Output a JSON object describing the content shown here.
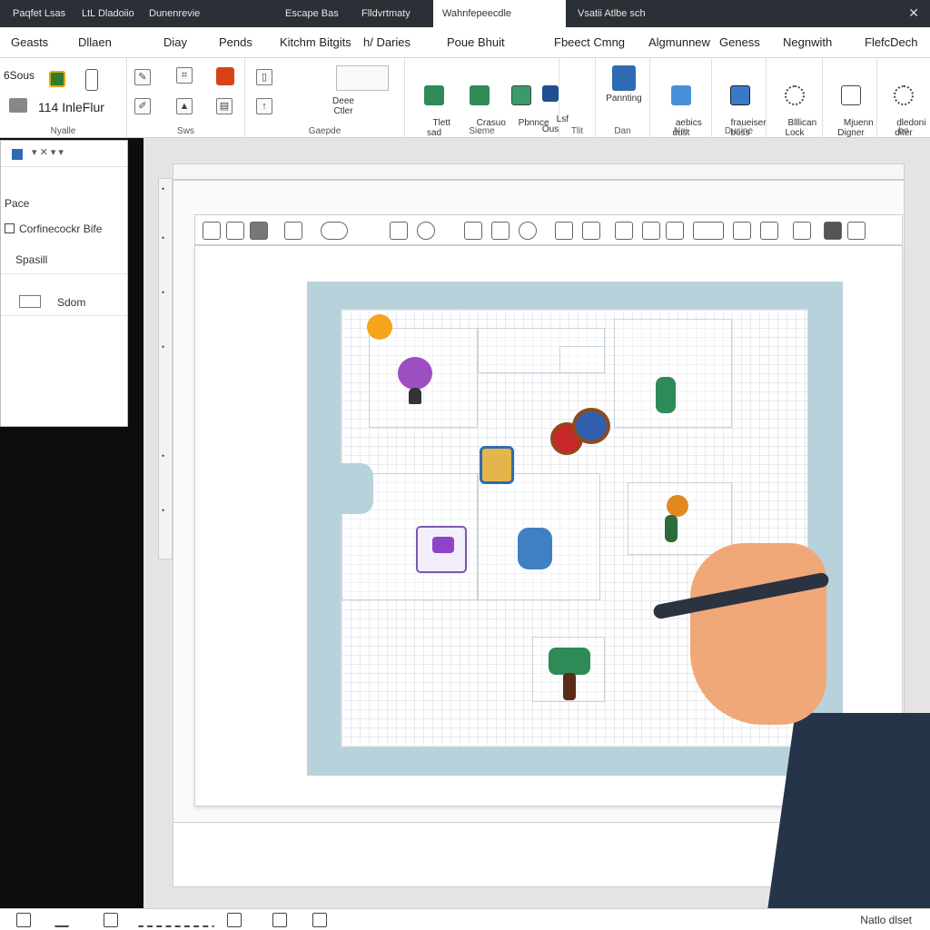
{
  "title_tabs": [
    "Paqfet Lsas",
    "LtL Dladoiio",
    "Dunenrevie",
    "Escape Bas",
    "Flldvrtmaty",
    "Wahnfepeecdle",
    "Vsatii Atlbe sch"
  ],
  "title_close": "✕",
  "menu": [
    "Geasts",
    "Dllaen",
    "Diay",
    "Pends",
    "Kitchm Bitgits",
    "h/ Daries",
    "Poue Bhuit",
    "Fbeect Cmng",
    "Algmunnew",
    "Geness",
    "Negnwith",
    "FlefcDech"
  ],
  "ribbon": {
    "left_label_top": "6Sous",
    "left_label_bottom": "114 InleFlur",
    "groups": [
      "Nyalle",
      "Sws",
      "Gaepde",
      "Sieme",
      "Tlit",
      "Dan",
      "Nei",
      "Dusine",
      "bo"
    ],
    "buttons": [
      {
        "label": "Deee\nCtler"
      },
      {
        "label": "Tlett\nsad"
      },
      {
        "label": "Crasuo\n-"
      },
      {
        "label": "Pbnnce"
      },
      {
        "label": "Lsf\nOus"
      },
      {
        "label": "Pannting"
      },
      {
        "label": "aebics\ndust"
      },
      {
        "label": "fraueiser\nboss"
      },
      {
        "label": "Blllican\nLock"
      },
      {
        "label": "Mjuenn\nDigner"
      },
      {
        "label": "dledoni\nditer"
      }
    ]
  },
  "side_panel": {
    "items": [
      "Pace",
      "Corfinecockr Bife",
      "Spasill",
      "Sdom"
    ]
  },
  "statusbar": {
    "right_text": "Natlo dlset"
  },
  "colors": {
    "titlebar": "#2b2f36",
    "board_bg": "#b7d2da",
    "accent_green": "#2e8b57",
    "accent_blue": "#2f6bb3",
    "sleeve": "#26344a",
    "skin": "#f0a878"
  },
  "icons": {
    "board": [
      "orange-coin-icon",
      "purple-monster-icon",
      "green-goblin-icon",
      "red-seal-icon",
      "blue-orb-icon",
      "gold-tile-icon",
      "purple-chest-icon",
      "blue-robot-icon",
      "orange-sprite-icon",
      "green-tree-creature-icon"
    ]
  }
}
